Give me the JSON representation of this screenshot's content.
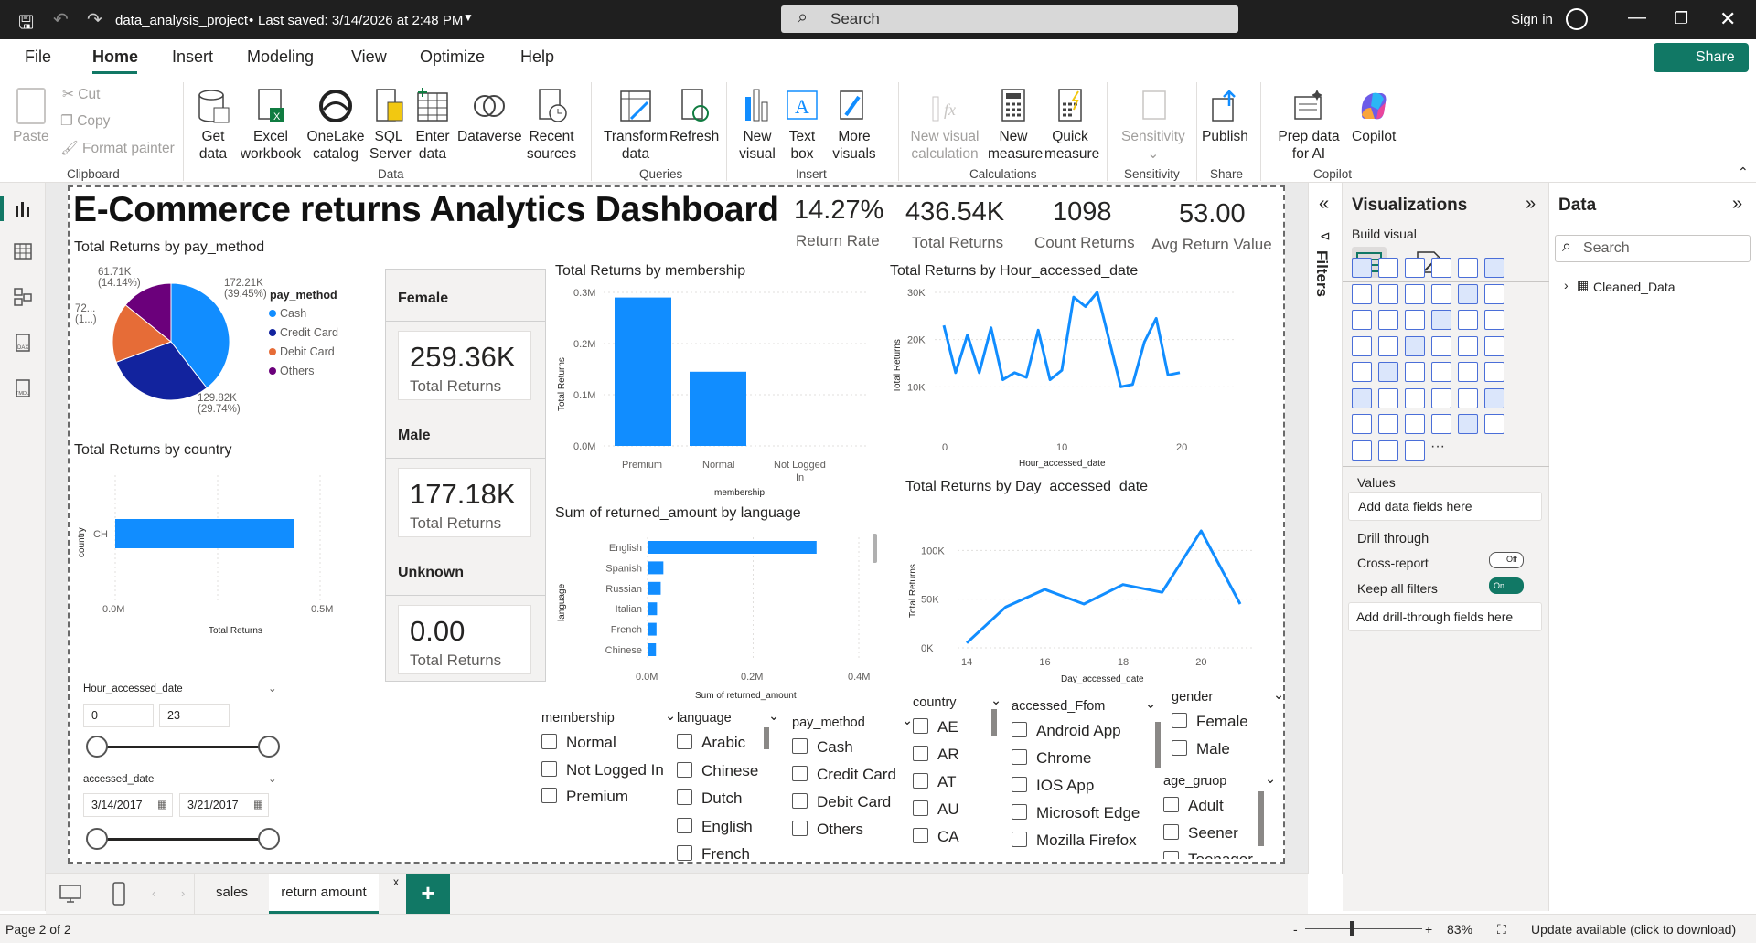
{
  "titlebar": {
    "project": "data_analysis_project",
    "saved": "Last saved: 3/14/2026 at 2:48 PM",
    "search": "Search",
    "signin": "Sign in"
  },
  "menu": [
    "File",
    "Home",
    "Insert",
    "Modeling",
    "View",
    "Optimize",
    "Help"
  ],
  "share": "Share",
  "ribbon": {
    "clipboard": {
      "paste": "Paste",
      "cut": "Cut",
      "copy": "Copy",
      "format_painter": "Format painter",
      "group": "Clipboard"
    },
    "data": {
      "get_data": "Get data",
      "excel": "Excel workbook",
      "onelake": "OneLake catalog",
      "sql": "SQL Server",
      "enter": "Enter data",
      "dataverse": "Dataverse",
      "recent": "Recent sources",
      "group": "Data"
    },
    "queries": {
      "transform": "Transform data",
      "refresh": "Refresh",
      "group": "Queries"
    },
    "insert": {
      "new_visual": "New visual",
      "text_box": "Text box",
      "more_visuals": "More visuals",
      "group": "Insert"
    },
    "calculations": {
      "new_visual_calc": "New visual calculation",
      "new_measure": "New measure",
      "quick_measure": "Quick measure",
      "group": "Calculations"
    },
    "sensitivity": {
      "label": "Sensitivity",
      "group": "Sensitivity"
    },
    "share": {
      "publish": "Publish",
      "group": "Share"
    },
    "copilot": {
      "prep": "Prep data for AI",
      "copilot": "Copilot",
      "group": "Copilot"
    }
  },
  "dashboard": {
    "title": "E-Commerce returns Analytics Dashboard",
    "kpis": [
      {
        "value": "14.27%",
        "label": "Return Rate"
      },
      {
        "value": "436.54K",
        "label": "Total Returns"
      },
      {
        "value": "1098",
        "label": "Count Returns"
      },
      {
        "value": "53.00",
        "label": "Avg Return Value"
      }
    ],
    "gender_cards": [
      {
        "header": "Female",
        "value": "259.36K",
        "label": "Total Returns"
      },
      {
        "header": "Male",
        "value": "177.18K",
        "label": "Total Returns"
      },
      {
        "header": "Unknown",
        "value": "0.00",
        "label": "Total Returns"
      }
    ],
    "pie_title": "Total Returns by pay_method",
    "pie_legend_title": "pay_method",
    "pie_labels": [
      "172.21K (39.45%)",
      "129.82K (29.74%)",
      "61.71K (14.14%)",
      "72... (1...)"
    ],
    "country_title": "Total Returns by country",
    "membership_title": "Total Returns by membership",
    "language_title": "Sum of returned_amount by language",
    "hour_title": "Total Returns by Hour_accessed_date",
    "day_title": "Total Returns by Day_accessed_date"
  },
  "chart_data": [
    {
      "type": "pie",
      "title": "Total Returns by pay_method",
      "legend_title": "pay_method",
      "series": [
        {
          "name": "Cash",
          "value": 172210
        },
        {
          "name": "Credit Card",
          "value": 129820
        },
        {
          "name": "Debit Card",
          "value": 72000
        },
        {
          "name": "Others",
          "value": 61710
        }
      ],
      "colors": [
        "#118dff",
        "#12239e",
        "#e66c37",
        "#6b007b"
      ],
      "legend": "right"
    },
    {
      "type": "bar",
      "orientation": "horizontal",
      "title": "Total Returns by country",
      "categories": [
        "CH"
      ],
      "values": [
        436540
      ],
      "xlabel": "Total Returns",
      "ylabel": "country",
      "xlim": [
        0,
        500000
      ],
      "ticks": [
        "0.0M",
        "0.5M"
      ]
    },
    {
      "type": "bar",
      "title": "Total Returns by membership",
      "categories": [
        "Premium",
        "Normal",
        "Not Logged In"
      ],
      "values": [
        290000,
        145000,
        0
      ],
      "xlabel": "membership",
      "ylabel": "Total Returns",
      "ylim": [
        0,
        300000
      ],
      "ticks": [
        "0.0M",
        "0.1M",
        "0.2M",
        "0.3M"
      ]
    },
    {
      "type": "bar",
      "orientation": "horizontal",
      "title": "Sum of returned_amount by language",
      "categories": [
        "English",
        "Spanish",
        "Russian",
        "Italian",
        "French",
        "Chinese"
      ],
      "values": [
        320000,
        30000,
        25000,
        18000,
        17000,
        16000
      ],
      "xlabel": "Sum of returned_amount",
      "ylabel": "language",
      "xlim": [
        0,
        400000
      ],
      "ticks": [
        "0.0M",
        "0.2M",
        "0.4M"
      ]
    },
    {
      "type": "line",
      "title": "Total Returns by Hour_accessed_date",
      "x": [
        0,
        1,
        2,
        3,
        4,
        5,
        6,
        7,
        8,
        9,
        10,
        11,
        12,
        13,
        14,
        15,
        16,
        17,
        18,
        19,
        20,
        21,
        22
      ],
      "values": [
        23000,
        13000,
        21000,
        13000,
        22500,
        11500,
        13000,
        12000,
        22000,
        11500,
        13500,
        29000,
        27000,
        30000,
        20000,
        10000,
        10500,
        19500,
        24500,
        12500,
        13000
      ],
      "xlabel": "Hour_accessed_date",
      "ylabel": "Total Returns",
      "ylim": [
        0,
        30000
      ],
      "yticks": [
        "10K",
        "20K",
        "30K"
      ],
      "xticks": [
        "0",
        "10",
        "20"
      ]
    },
    {
      "type": "line",
      "title": "Total Returns by Day_accessed_date",
      "x": [
        14,
        15,
        16,
        17,
        18,
        19,
        20,
        21
      ],
      "values": [
        5000,
        42000,
        60000,
        45000,
        65000,
        57000,
        120000,
        45000
      ],
      "xlabel": "Day_accessed_date",
      "ylabel": "Total Returns",
      "ylim": [
        0,
        120000
      ],
      "yticks": [
        "0K",
        "50K",
        "100K"
      ],
      "xticks": [
        "14",
        "16",
        "18",
        "20"
      ]
    }
  ],
  "slicers": {
    "hour": {
      "label": "Hour_accessed_date",
      "min": "0",
      "max": "23"
    },
    "date": {
      "label": "accessed_date",
      "from": "3/14/2017",
      "to": "3/21/2017"
    },
    "membership": {
      "label": "membership",
      "items": [
        "Normal",
        "Not Logged In",
        "Premium"
      ]
    },
    "language": {
      "label": "language",
      "items": [
        "Arabic",
        "Chinese",
        "Dutch",
        "English",
        "French"
      ]
    },
    "pay_method": {
      "label": "pay_method",
      "items": [
        "Cash",
        "Credit Card",
        "Debit Card",
        "Others"
      ]
    },
    "country": {
      "label": "country",
      "items": [
        "AE",
        "AR",
        "AT",
        "AU",
        "CA"
      ]
    },
    "accessed_from": {
      "label": "accessed_Ffom",
      "items": [
        "Android App",
        "Chrome",
        "IOS App",
        "Microsoft Edge",
        "Mozilla Firefox"
      ]
    },
    "gender": {
      "label": "gender",
      "items": [
        "Female",
        "Male"
      ]
    },
    "age_group": {
      "label": "age_gruop",
      "items": [
        "Adult",
        "Seener",
        "Teenager"
      ]
    }
  },
  "filters_label": "Filters",
  "viz": {
    "title": "Visualizations",
    "build": "Build visual",
    "values": "Values",
    "add_data": "Add data fields here",
    "drill": "Drill through",
    "cross": "Cross-report",
    "cross_state": "Off",
    "keep": "Keep all filters",
    "keep_state": "On",
    "add_drill": "Add drill-through fields here"
  },
  "datapane": {
    "title": "Data",
    "search": "Search",
    "table": "Cleaned_Data"
  },
  "tabs": [
    "sales",
    "return amount"
  ],
  "status": {
    "page": "Page 2 of 2",
    "zoom": "83%",
    "update": "Update available (click to download)"
  },
  "colors": {
    "accent": "#118dff",
    "navy": "#12239e",
    "orange": "#e66c37",
    "purple": "#6b007b",
    "share": "#117865"
  }
}
